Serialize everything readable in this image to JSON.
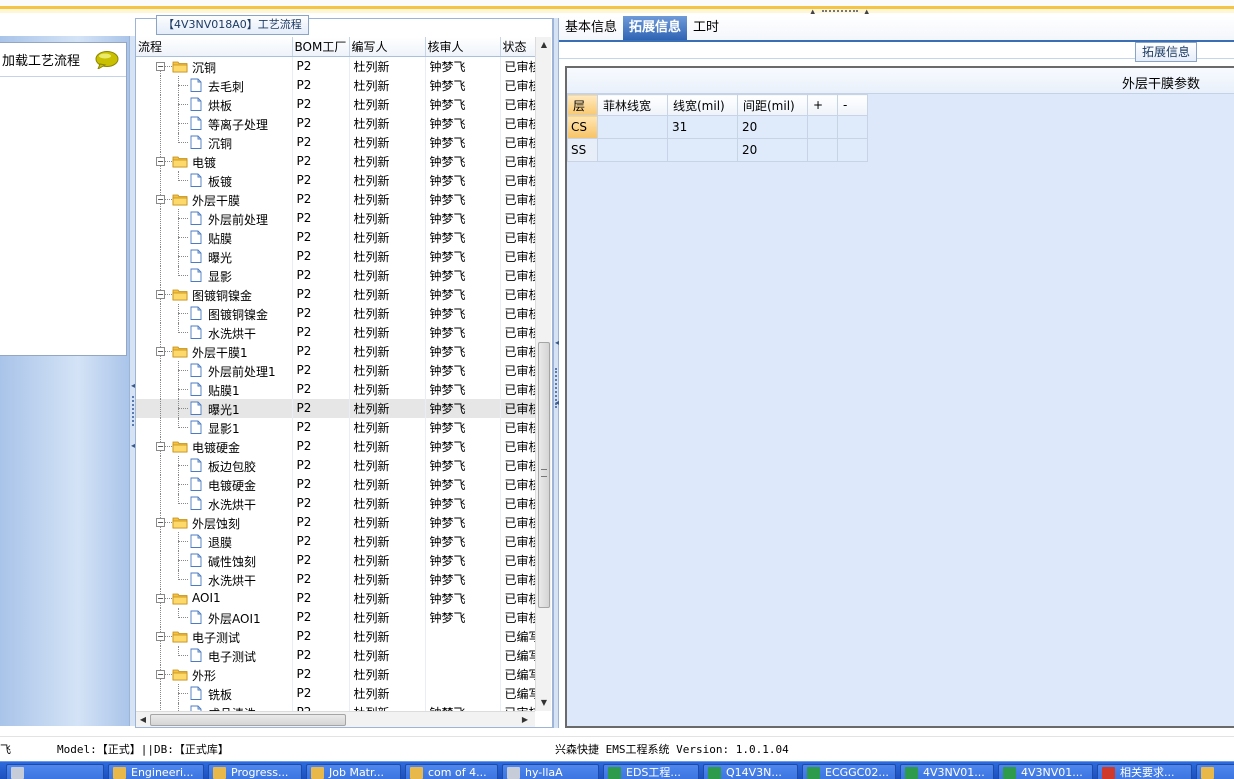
{
  "tree_panel": {
    "title": "【4V3NV018A0】工艺流程"
  },
  "left_panel": {
    "load_label": "加载工艺流程"
  },
  "tree": {
    "columns": [
      "流程",
      "BOM工厂",
      "编写人",
      "核审人",
      "状态"
    ],
    "rows": [
      {
        "name": "沉铜",
        "level": 0,
        "icon": "folder-icon",
        "bom": "P2",
        "writer": "杜列新",
        "reviewer": "钟梦飞",
        "status": "已审核"
      },
      {
        "name": "去毛刺",
        "level": 1,
        "icon": "document-icon",
        "bom": "P2",
        "writer": "杜列新",
        "reviewer": "钟梦飞",
        "status": "已审核"
      },
      {
        "name": "烘板",
        "level": 1,
        "icon": "document-icon",
        "bom": "P2",
        "writer": "杜列新",
        "reviewer": "钟梦飞",
        "status": "已审核"
      },
      {
        "name": "等离子处理",
        "level": 1,
        "icon": "document-icon",
        "bom": "P2",
        "writer": "杜列新",
        "reviewer": "钟梦飞",
        "status": "已审核"
      },
      {
        "name": "沉铜",
        "level": 1,
        "icon": "document-icon",
        "bom": "P2",
        "writer": "杜列新",
        "reviewer": "钟梦飞",
        "status": "已审核"
      },
      {
        "name": "电镀",
        "level": 0,
        "icon": "folder-icon",
        "bom": "P2",
        "writer": "杜列新",
        "reviewer": "钟梦飞",
        "status": "已审核"
      },
      {
        "name": "板镀",
        "level": 1,
        "icon": "document-icon",
        "bom": "P2",
        "writer": "杜列新",
        "reviewer": "钟梦飞",
        "status": "已审核"
      },
      {
        "name": "外层干膜",
        "level": 0,
        "icon": "folder-icon",
        "bom": "P2",
        "writer": "杜列新",
        "reviewer": "钟梦飞",
        "status": "已审核"
      },
      {
        "name": "外层前处理",
        "level": 1,
        "icon": "document-icon",
        "bom": "P2",
        "writer": "杜列新",
        "reviewer": "钟梦飞",
        "status": "已审核"
      },
      {
        "name": "贴膜",
        "level": 1,
        "icon": "document-icon",
        "bom": "P2",
        "writer": "杜列新",
        "reviewer": "钟梦飞",
        "status": "已审核"
      },
      {
        "name": "曝光",
        "level": 1,
        "icon": "document-icon",
        "bom": "P2",
        "writer": "杜列新",
        "reviewer": "钟梦飞",
        "status": "已审核"
      },
      {
        "name": "显影",
        "level": 1,
        "icon": "document-icon",
        "bom": "P2",
        "writer": "杜列新",
        "reviewer": "钟梦飞",
        "status": "已审核"
      },
      {
        "name": "图镀铜镍金",
        "level": 0,
        "icon": "folder-icon",
        "bom": "P2",
        "writer": "杜列新",
        "reviewer": "钟梦飞",
        "status": "已审核"
      },
      {
        "name": "图镀铜镍金",
        "level": 1,
        "icon": "document-icon",
        "bom": "P2",
        "writer": "杜列新",
        "reviewer": "钟梦飞",
        "status": "已审核"
      },
      {
        "name": "水洗烘干",
        "level": 1,
        "icon": "document-icon",
        "bom": "P2",
        "writer": "杜列新",
        "reviewer": "钟梦飞",
        "status": "已审核"
      },
      {
        "name": "外层干膜1",
        "level": 0,
        "icon": "folder-icon",
        "bom": "P2",
        "writer": "杜列新",
        "reviewer": "钟梦飞",
        "status": "已审核"
      },
      {
        "name": "外层前处理1",
        "level": 1,
        "icon": "document-icon",
        "bom": "P2",
        "writer": "杜列新",
        "reviewer": "钟梦飞",
        "status": "已审核"
      },
      {
        "name": "贴膜1",
        "level": 1,
        "icon": "document-icon",
        "bom": "P2",
        "writer": "杜列新",
        "reviewer": "钟梦飞",
        "status": "已审核"
      },
      {
        "name": "曝光1",
        "level": 1,
        "icon": "document-icon",
        "bom": "P2",
        "writer": "杜列新",
        "reviewer": "钟梦飞",
        "status": "已审核",
        "selected": true
      },
      {
        "name": "显影1",
        "level": 1,
        "icon": "document-icon",
        "bom": "P2",
        "writer": "杜列新",
        "reviewer": "钟梦飞",
        "status": "已审核"
      },
      {
        "name": "电镀硬金",
        "level": 0,
        "icon": "folder-icon",
        "bom": "P2",
        "writer": "杜列新",
        "reviewer": "钟梦飞",
        "status": "已审核"
      },
      {
        "name": "板边包胶",
        "level": 1,
        "icon": "document-icon",
        "bom": "P2",
        "writer": "杜列新",
        "reviewer": "钟梦飞",
        "status": "已审核"
      },
      {
        "name": "电镀硬金",
        "level": 1,
        "icon": "document-icon",
        "bom": "P2",
        "writer": "杜列新",
        "reviewer": "钟梦飞",
        "status": "已审核"
      },
      {
        "name": "水洗烘干",
        "level": 1,
        "icon": "document-icon",
        "bom": "P2",
        "writer": "杜列新",
        "reviewer": "钟梦飞",
        "status": "已审核"
      },
      {
        "name": "外层蚀刻",
        "level": 0,
        "icon": "folder-icon",
        "bom": "P2",
        "writer": "杜列新",
        "reviewer": "钟梦飞",
        "status": "已审核"
      },
      {
        "name": "退膜",
        "level": 1,
        "icon": "document-icon",
        "bom": "P2",
        "writer": "杜列新",
        "reviewer": "钟梦飞",
        "status": "已审核"
      },
      {
        "name": "碱性蚀刻",
        "level": 1,
        "icon": "document-icon",
        "bom": "P2",
        "writer": "杜列新",
        "reviewer": "钟梦飞",
        "status": "已审核"
      },
      {
        "name": "水洗烘干",
        "level": 1,
        "icon": "document-icon",
        "bom": "P2",
        "writer": "杜列新",
        "reviewer": "钟梦飞",
        "status": "已审核"
      },
      {
        "name": "AOI1",
        "level": 0,
        "icon": "folder-icon",
        "bom": "P2",
        "writer": "杜列新",
        "reviewer": "钟梦飞",
        "status": "已审核"
      },
      {
        "name": "外层AOI1",
        "level": 1,
        "icon": "document-icon",
        "bom": "P2",
        "writer": "杜列新",
        "reviewer": "钟梦飞",
        "status": "已审核"
      },
      {
        "name": "电子测试",
        "level": 0,
        "icon": "folder-icon",
        "bom": "P2",
        "writer": "杜列新",
        "reviewer": "",
        "status": "已编写"
      },
      {
        "name": "电子测试",
        "level": 1,
        "icon": "document-icon",
        "bom": "P2",
        "writer": "杜列新",
        "reviewer": "",
        "status": "已编写"
      },
      {
        "name": "外形",
        "level": 0,
        "icon": "folder-icon",
        "bom": "P2",
        "writer": "杜列新",
        "reviewer": "",
        "status": "已编写"
      },
      {
        "name": "铣板",
        "level": 1,
        "icon": "document-icon",
        "bom": "P2",
        "writer": "杜列新",
        "reviewer": "",
        "status": "已编写"
      },
      {
        "name": "成品清洗",
        "level": 1,
        "icon": "document-icon",
        "bom": "P2",
        "writer": "杜列新",
        "reviewer": "钟梦飞",
        "status": "已审核"
      }
    ]
  },
  "right_panel": {
    "tabs": [
      "基本信息",
      "拓展信息",
      "工时"
    ],
    "active_tab": 1,
    "group_title": "拓展信息",
    "section_title": "外层干膜参数",
    "params_table": {
      "columns": [
        "层",
        "菲林线宽",
        "线宽(mil)",
        "间距(mil)",
        "+",
        "-"
      ],
      "rows": [
        [
          "CS",
          "",
          "31",
          "20",
          "",
          ""
        ],
        [
          "SS",
          "",
          "",
          "20",
          "",
          ""
        ]
      ]
    }
  },
  "status_bar": {
    "left_fragment": "飞",
    "model": "Model:【正式】||DB:【正式库】",
    "app_version": "兴森快捷 EMS工程系统 Version: 1.0.1.04"
  },
  "taskbar": {
    "items": [
      {
        "label": "",
        "icon": "start-icon"
      },
      {
        "label": "Engineeri...",
        "icon": "app-icon"
      },
      {
        "label": "Progress...",
        "icon": "app-icon"
      },
      {
        "label": "Job Matr...",
        "icon": "app-icon"
      },
      {
        "label": "com of 4...",
        "icon": "app-icon"
      },
      {
        "label": "hy-llaA",
        "icon": "disk-icon"
      },
      {
        "label": "EDS工程...",
        "icon": "excel-icon"
      },
      {
        "label": "Q14V3N...",
        "icon": "excel-icon"
      },
      {
        "label": "ECGGC02...",
        "icon": "excel-icon"
      },
      {
        "label": "4V3NV01...",
        "icon": "excel-icon"
      },
      {
        "label": "4V3NV01...",
        "icon": "excel-icon"
      },
      {
        "label": "相关要求...",
        "icon": "pdf-icon"
      },
      {
        "label": "",
        "icon": "app-icon"
      }
    ]
  },
  "colors": {
    "accent": "#2f64b4",
    "selection": "#e6e6e6",
    "highlight": "#f7c265",
    "taskbar": "#2e6bdc"
  }
}
